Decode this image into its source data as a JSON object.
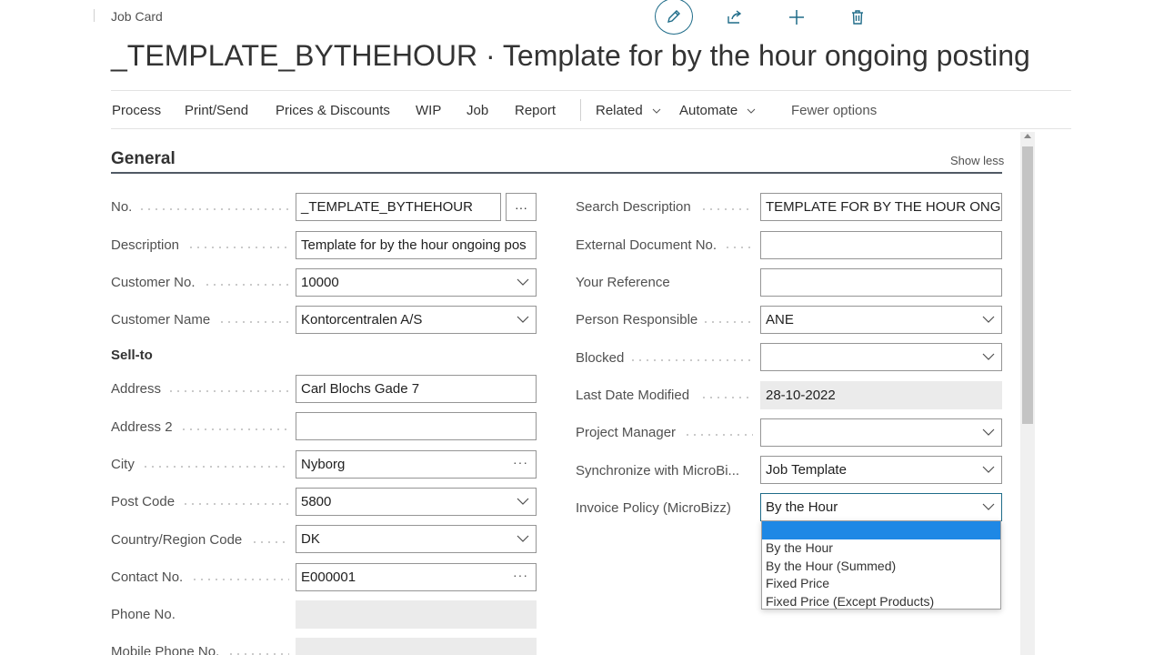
{
  "breadcrumb": "Job Card",
  "title": "_TEMPLATE_BYTHEHOUR · Template for by the hour ongoing posting",
  "actions": {
    "edit_icon": "pencil-icon",
    "share_icon": "share-icon",
    "add_icon": "plus-icon",
    "delete_icon": "trash-icon"
  },
  "menu": {
    "process": "Process",
    "print_send": "Print/Send",
    "prices_discounts": "Prices & Discounts",
    "wip": "WIP",
    "job": "Job",
    "report": "Report",
    "related": "Related",
    "automate": "Automate",
    "fewer_options": "Fewer options"
  },
  "section": {
    "title": "General",
    "show_less": "Show less"
  },
  "left": {
    "no_label": "No.",
    "no_value": "_TEMPLATE_BYTHEHOUR",
    "description_label": "Description",
    "description_value": "Template for by the hour ongoing pos",
    "customer_no_label": "Customer No.",
    "customer_no_value": "10000",
    "customer_name_label": "Customer Name",
    "customer_name_value": "Kontorcentralen A/S",
    "sell_to_label": "Sell-to",
    "address_label": "Address",
    "address_value": "Carl Blochs Gade 7",
    "address2_label": "Address 2",
    "address2_value": "",
    "city_label": "City",
    "city_value": "Nyborg",
    "post_code_label": "Post Code",
    "post_code_value": "5800",
    "country_label": "Country/Region Code",
    "country_value": "DK",
    "contact_no_label": "Contact No.",
    "contact_no_value": "E000001",
    "phone_label": "Phone No.",
    "phone_value": "",
    "mobile_label": "Mobile Phone No.",
    "mobile_value": ""
  },
  "right": {
    "search_desc_label": "Search Description",
    "search_desc_value": "TEMPLATE FOR BY THE HOUR ONGOII",
    "ext_doc_label": "External Document No.",
    "ext_doc_value": "",
    "your_ref_label": "Your Reference",
    "your_ref_value": "",
    "person_resp_label": "Person Responsible",
    "person_resp_value": "ANE",
    "blocked_label": "Blocked",
    "blocked_value": "",
    "last_modified_label": "Last Date Modified",
    "last_modified_value": "28-10-2022",
    "project_mgr_label": "Project Manager",
    "project_mgr_value": "",
    "sync_label": "Synchronize with MicroBi...",
    "sync_value": "Job Template",
    "invoice_policy_label": "Invoice Policy (MicroBizz)",
    "invoice_policy_value": "By the Hour"
  },
  "dropdown_options": [
    "",
    "By the Hour",
    "By the Hour (Summed)",
    "Fixed Price",
    "Fixed Price (Except Products)"
  ],
  "colors": {
    "accent": "#1f6c89",
    "selected_option": "#1e88e5",
    "readonly_bg": "#ebebeb"
  }
}
